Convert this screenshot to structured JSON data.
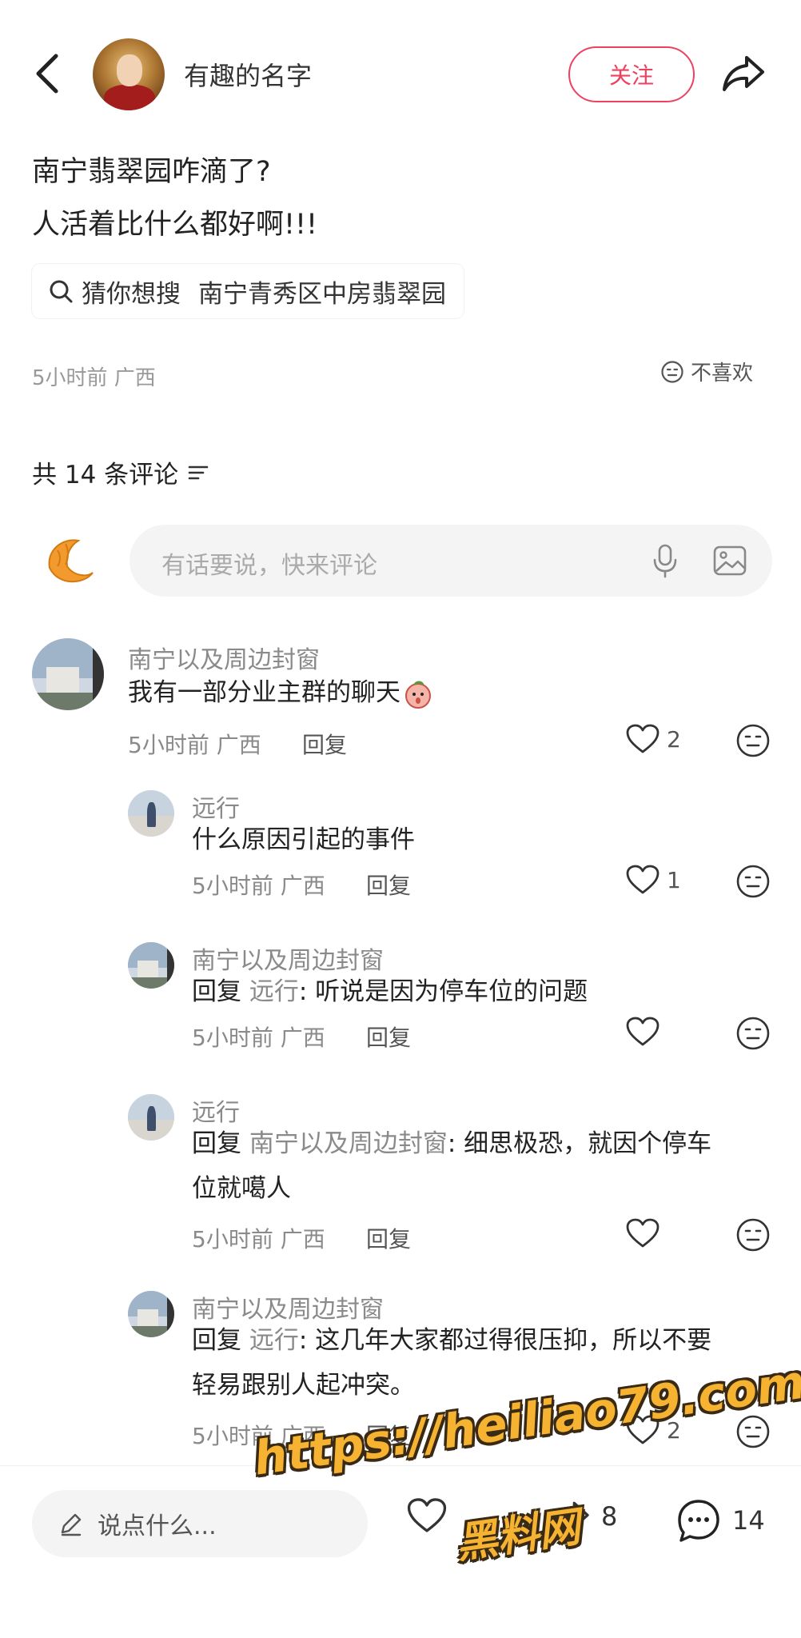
{
  "header": {
    "author_name": "有趣的名字",
    "follow_label": "关注"
  },
  "post": {
    "line1": "南宁翡翠园咋滴了?",
    "line2": "人活着比什么都好啊!!!",
    "search_chip": {
      "label": "猜你想搜",
      "query": "南宁青秀区中房翡翠园"
    },
    "meta": "5小时前 广西",
    "dislike_label": "不喜欢"
  },
  "comments_header": {
    "count_label": "共 14 条评论"
  },
  "composer": {
    "placeholder": "有话要说，快来评论"
  },
  "comments": [
    {
      "name": "南宁以及周边封窗",
      "text": "我有一部分业主群的聊天",
      "time": "5小时前 广西",
      "reply_label": "回复",
      "likes": "2"
    },
    {
      "name": "远行",
      "text": "什么原因引起的事件",
      "time": "5小时前 广西",
      "reply_label": "回复",
      "likes": "1"
    },
    {
      "name": "南宁以及周边封窗",
      "prefix": "回复",
      "ref": "远行",
      "text": ": 听说是因为停车位的问题",
      "time": "5小时前 广西",
      "reply_label": "回复",
      "likes": ""
    },
    {
      "name": "远行",
      "prefix": "回复",
      "ref": "南宁以及周边封窗",
      "text_line1": ": 细思极恐，就因个停车",
      "text_line2": "位就噶人",
      "time": "5小时前 广西",
      "reply_label": "回复",
      "likes": ""
    },
    {
      "name": "南宁以及周边封窗",
      "prefix": "回复",
      "ref": "远行",
      "text_line1": ": 这几年大家都过得很压抑，所以不要",
      "text_line2": "轻易跟别人起冲突。",
      "time": "5小时前 广西",
      "reply_label": "回复",
      "likes": "2"
    }
  ],
  "bottom_bar": {
    "say_placeholder": "说点什么...",
    "shares": "8",
    "comments": "14"
  },
  "watermark": {
    "url": "https://heiliao79.com",
    "name": "黑料网"
  },
  "colors": {
    "accent": "#ee4160",
    "muted": "#8a8a8a",
    "watermark": "#f5b331"
  }
}
